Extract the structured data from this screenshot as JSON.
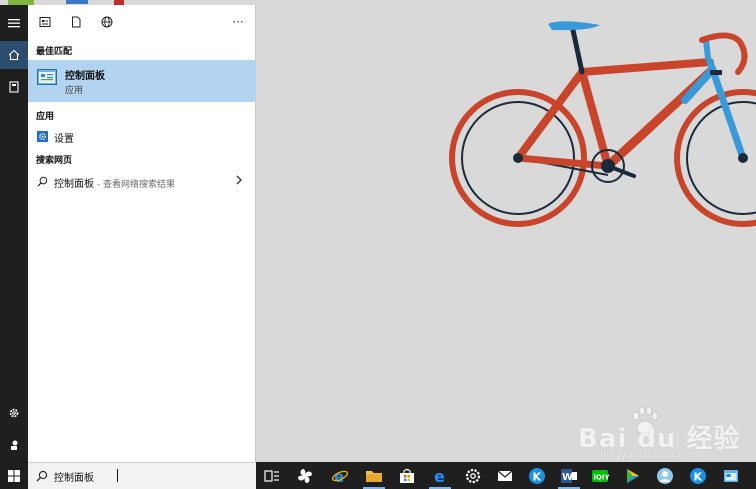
{
  "filters": [
    {
      "name": "apps-filter",
      "icon": "apps-icon"
    },
    {
      "name": "documents-filter",
      "icon": "document-icon"
    },
    {
      "name": "web-filter",
      "icon": "globe-icon"
    }
  ],
  "more_label": "···",
  "sections": {
    "best_match": "最佳匹配",
    "apps": "应用",
    "web": "搜索网页"
  },
  "best_match": {
    "title": "控制面板",
    "subtitle": "应用",
    "icon": "control-panel-icon"
  },
  "apps": [
    {
      "label": "设置",
      "icon": "gear-icon"
    }
  ],
  "web": [
    {
      "label": "控制面板",
      "hint": " - 查看网络搜索结果",
      "icon": "search-icon"
    }
  ],
  "search": {
    "value": "控制面板"
  },
  "watermark": {
    "logo": "Bai du 经验",
    "url": "jingyan.baidu.com"
  },
  "taskbar": {
    "apps": [
      {
        "name": "task-view",
        "icon": "task-view-icon"
      },
      {
        "name": "pinwheel-app",
        "icon": "pinwheel-icon"
      },
      {
        "name": "internet-explorer",
        "icon": "ie-icon"
      },
      {
        "name": "file-explorer",
        "icon": "folder-icon"
      },
      {
        "name": "store",
        "icon": "store-icon"
      },
      {
        "name": "edge",
        "icon": "edge-icon"
      },
      {
        "name": "settings",
        "icon": "gear-icon"
      },
      {
        "name": "mail",
        "icon": "mail-icon"
      },
      {
        "name": "kugou",
        "icon": "k-icon"
      },
      {
        "name": "word",
        "icon": "word-icon"
      },
      {
        "name": "iqiyi",
        "icon": "iqiyi-icon"
      },
      {
        "name": "media-player",
        "icon": "play-icon"
      },
      {
        "name": "avatar-app",
        "icon": "avatar-icon"
      },
      {
        "name": "kugou-2",
        "icon": "k-icon"
      },
      {
        "name": "desktop-app",
        "icon": "window-icon"
      }
    ]
  },
  "colors": {
    "accent": "#b3d4f0",
    "taskbar": "#1f1f1f",
    "bike_frame": "#c8442a",
    "bike_fork": "#3a9ad9"
  }
}
